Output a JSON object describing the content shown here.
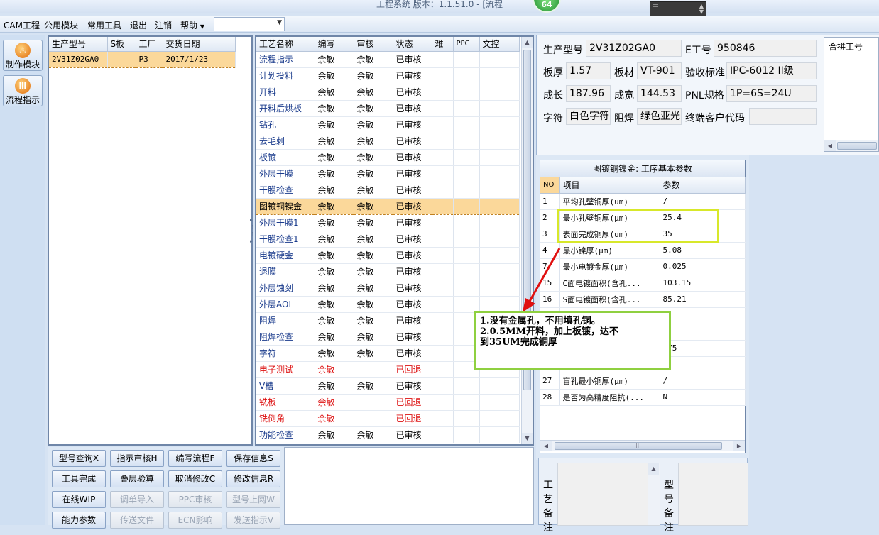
{
  "titlebar": {
    "title": "工程系统   版本：1.1.51.0 - [流程",
    "badge": "64"
  },
  "menu": {
    "items": [
      "CAM工程",
      "公用模块",
      "常用工具",
      "退出",
      "注销",
      "帮助"
    ],
    "combo_value": ""
  },
  "leftbar": {
    "buttons": [
      {
        "label": "制作模块",
        "icon": "flame-icon"
      },
      {
        "label": "流程指示",
        "icon": "bars-icon"
      }
    ]
  },
  "orders": {
    "columns": [
      "生产型号",
      "S板",
      "工厂",
      "交货日期"
    ],
    "rows": [
      [
        "2V31Z02GA0",
        "",
        "P3",
        "2017/1/23"
      ]
    ]
  },
  "process": {
    "columns": [
      "工艺名称",
      "编写",
      "审核",
      "状态",
      "难",
      "PPC",
      "文控"
    ],
    "rows": [
      [
        "流程指示",
        "余敏",
        "余敏",
        "已审核",
        "",
        "",
        ""
      ],
      [
        "计划投料",
        "余敏",
        "余敏",
        "已审核",
        "",
        "",
        ""
      ],
      [
        "开料",
        "余敏",
        "余敏",
        "已审核",
        "",
        "",
        ""
      ],
      [
        "开料后烘板",
        "余敏",
        "余敏",
        "已审核",
        "",
        "",
        ""
      ],
      [
        "钻孔",
        "余敏",
        "余敏",
        "已审核",
        "",
        "",
        ""
      ],
      [
        "去毛刺",
        "余敏",
        "余敏",
        "已审核",
        "",
        "",
        ""
      ],
      [
        "板镀",
        "余敏",
        "余敏",
        "已审核",
        "",
        "",
        ""
      ],
      [
        "外层干膜",
        "余敏",
        "余敏",
        "已审核",
        "",
        "",
        ""
      ],
      [
        "干膜检查",
        "余敏",
        "余敏",
        "已审核",
        "",
        "",
        ""
      ],
      [
        "图镀铜镍金",
        "余敏",
        "余敏",
        "已审核",
        "",
        "",
        ""
      ],
      [
        "外层干膜1",
        "余敏",
        "余敏",
        "已审核",
        "",
        "",
        ""
      ],
      [
        "干膜检查1",
        "余敏",
        "余敏",
        "已审核",
        "",
        "",
        ""
      ],
      [
        "电镀硬金",
        "余敏",
        "余敏",
        "已审核",
        "",
        "",
        ""
      ],
      [
        "退膜",
        "余敏",
        "余敏",
        "已审核",
        "",
        "",
        ""
      ],
      [
        "外层蚀刻",
        "余敏",
        "余敏",
        "已审核",
        "",
        "",
        ""
      ],
      [
        "外层AOI",
        "余敏",
        "余敏",
        "已审核",
        "",
        "",
        ""
      ],
      [
        "阻焊",
        "余敏",
        "余敏",
        "已审核",
        "",
        "",
        ""
      ],
      [
        "阻焊检查",
        "余敏",
        "余敏",
        "已审核",
        "",
        "",
        ""
      ],
      [
        "字符",
        "余敏",
        "余敏",
        "已审核",
        "",
        "",
        ""
      ],
      [
        "电子测试",
        "余敏",
        "",
        "已回退",
        "",
        "",
        ""
      ],
      [
        "V槽",
        "余敏",
        "余敏",
        "已审核",
        "",
        "",
        ""
      ],
      [
        "铣板",
        "余敏",
        "",
        "已回退",
        "",
        "",
        ""
      ],
      [
        "铣倒角",
        "余敏",
        "",
        "已回退",
        "",
        "",
        ""
      ],
      [
        "功能检查",
        "余敏",
        "余敏",
        "已审核",
        "",
        "",
        ""
      ]
    ],
    "selected_index": 9,
    "returned_indices": [
      19,
      21,
      22
    ]
  },
  "actions": {
    "buttons": [
      [
        "型号查询X",
        "指示审核H",
        "编写流程F",
        "保存信息S"
      ],
      [
        "工具完成",
        "叠层验算",
        "取消修改C",
        "修改信息R"
      ],
      [
        "在线WIP",
        "调单导入",
        "PPC审核",
        "型号上网W"
      ],
      [
        "能力参数",
        "传送文件",
        "ECN影响",
        "发送指示V"
      ]
    ],
    "disabled": [
      [
        2,
        1
      ],
      [
        2,
        2
      ],
      [
        2,
        3
      ],
      [
        3,
        1
      ],
      [
        3,
        2
      ],
      [
        3,
        3
      ]
    ]
  },
  "info": {
    "model_label": "生产型号",
    "model_value": "2V31Z02GA0",
    "eno_label": "E工号",
    "eno_value": "950846",
    "thick_label": "板厚",
    "thick_value": "1.57",
    "mat_label": "板材",
    "mat_value": "VT-901",
    "std_label": "验收标准",
    "std_value": "IPC-6012 II级",
    "len_label": "成长",
    "len_value": "187.96",
    "wid_label": "成宽",
    "wid_value": "144.53",
    "pnl_label": "PNL规格",
    "pnl_value": "1P=6S=24U",
    "char_label": "字符",
    "char_value": "白色字符",
    "mask_label": "阻焊",
    "mask_value": "绿色亚光",
    "cust_label": "终端客户代码",
    "cust_value": "",
    "merge_label": "合拼工号"
  },
  "params": {
    "title": "图镀铜镍金: 工序基本参数",
    "columns": [
      "NO",
      "项目",
      "参数"
    ],
    "rows": [
      [
        "1",
        "平均孔壁铜厚(um)",
        "/"
      ],
      [
        "2",
        "最小孔壁铜厚(μm)",
        "25.4"
      ],
      [
        "3",
        "表面完成铜厚(um)",
        "35"
      ],
      [
        "4",
        "最小镍厚(μm)",
        "5.08"
      ],
      [
        "7",
        "最小电镀金厚(μm)",
        "0.025"
      ],
      [
        "15",
        "C面电镀面积(含孔...",
        "103.15"
      ],
      [
        "16",
        "S面电镀面积(含孔...",
        "85.21"
      ],
      [
        "",
        "",
        ""
      ],
      [
        "",
        "",
        ""
      ],
      [
        "",
        "",
        "075"
      ],
      [
        "",
        "",
        ""
      ],
      [
        "27",
        "盲孔最小铜厚(μm)",
        "/"
      ],
      [
        "28",
        "是否为高精度阻抗(...",
        "N"
      ]
    ]
  },
  "remarks": {
    "left_label": "工艺备注",
    "right_label": "型号备注"
  },
  "annotation": {
    "lines": [
      "1.没有金属孔，不用填孔铜。",
      "2.0.5MM开料，加上板镀，达不",
      "到35UM完成铜厚"
    ],
    "highlight_color": "#d8e82a",
    "note_border_color": "#8fd040",
    "arrow_color": "#e01010"
  }
}
